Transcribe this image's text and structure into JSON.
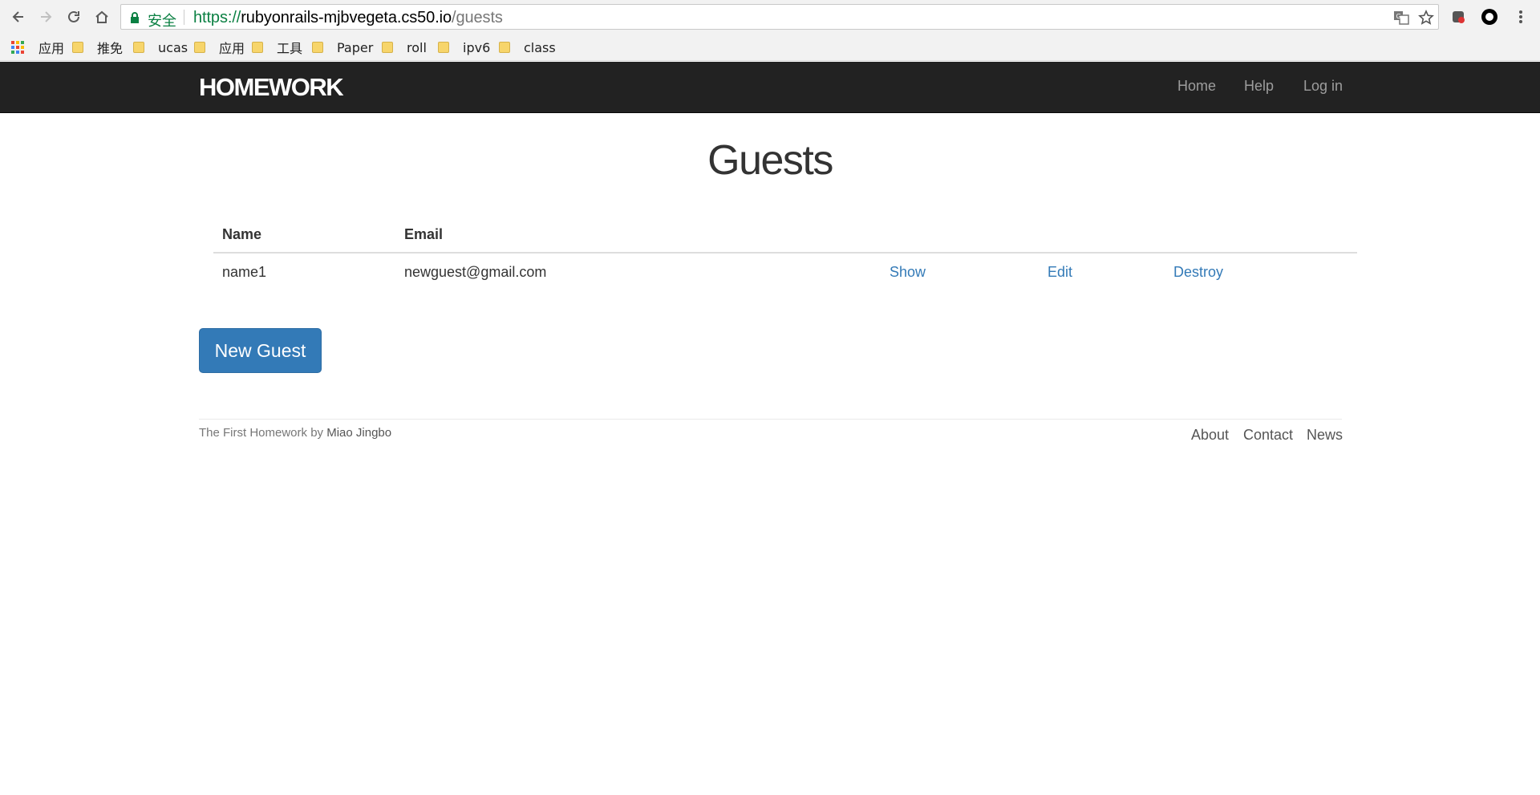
{
  "browser": {
    "secure_label": "安全",
    "url_scheme": "https://",
    "url_host": "rubyonrails-mjbvegeta.cs50.io",
    "url_path": "/guests",
    "bookmarks": [
      {
        "label": "应用",
        "icon": "apps-icon"
      },
      {
        "label": "推免",
        "icon": "folder-icon"
      },
      {
        "label": "ucas",
        "icon": "folder-icon"
      },
      {
        "label": "应用",
        "icon": "folder-icon"
      },
      {
        "label": "工具",
        "icon": "folder-icon"
      },
      {
        "label": "Paper",
        "icon": "folder-icon"
      },
      {
        "label": "roll",
        "icon": "folder-icon"
      },
      {
        "label": "ipv6",
        "icon": "folder-icon"
      },
      {
        "label": "class",
        "icon": "folder-icon"
      }
    ]
  },
  "navbar": {
    "brand": "HOMEWORK",
    "links": [
      "Home",
      "Help",
      "Log in"
    ],
    "background": "#222222"
  },
  "main": {
    "title": "Guests",
    "table": {
      "headers": [
        "Name",
        "Email"
      ],
      "rows": [
        {
          "name": "name1",
          "email": "newguest@gmail.com",
          "show": "Show",
          "edit": "Edit",
          "destroy": "Destroy"
        }
      ]
    },
    "new_button": "New Guest",
    "accent": "#337ab7"
  },
  "footer": {
    "prefix": "The First Homework by",
    "author": "Miao Jingbo",
    "links": [
      "About",
      "Contact",
      "News"
    ]
  }
}
